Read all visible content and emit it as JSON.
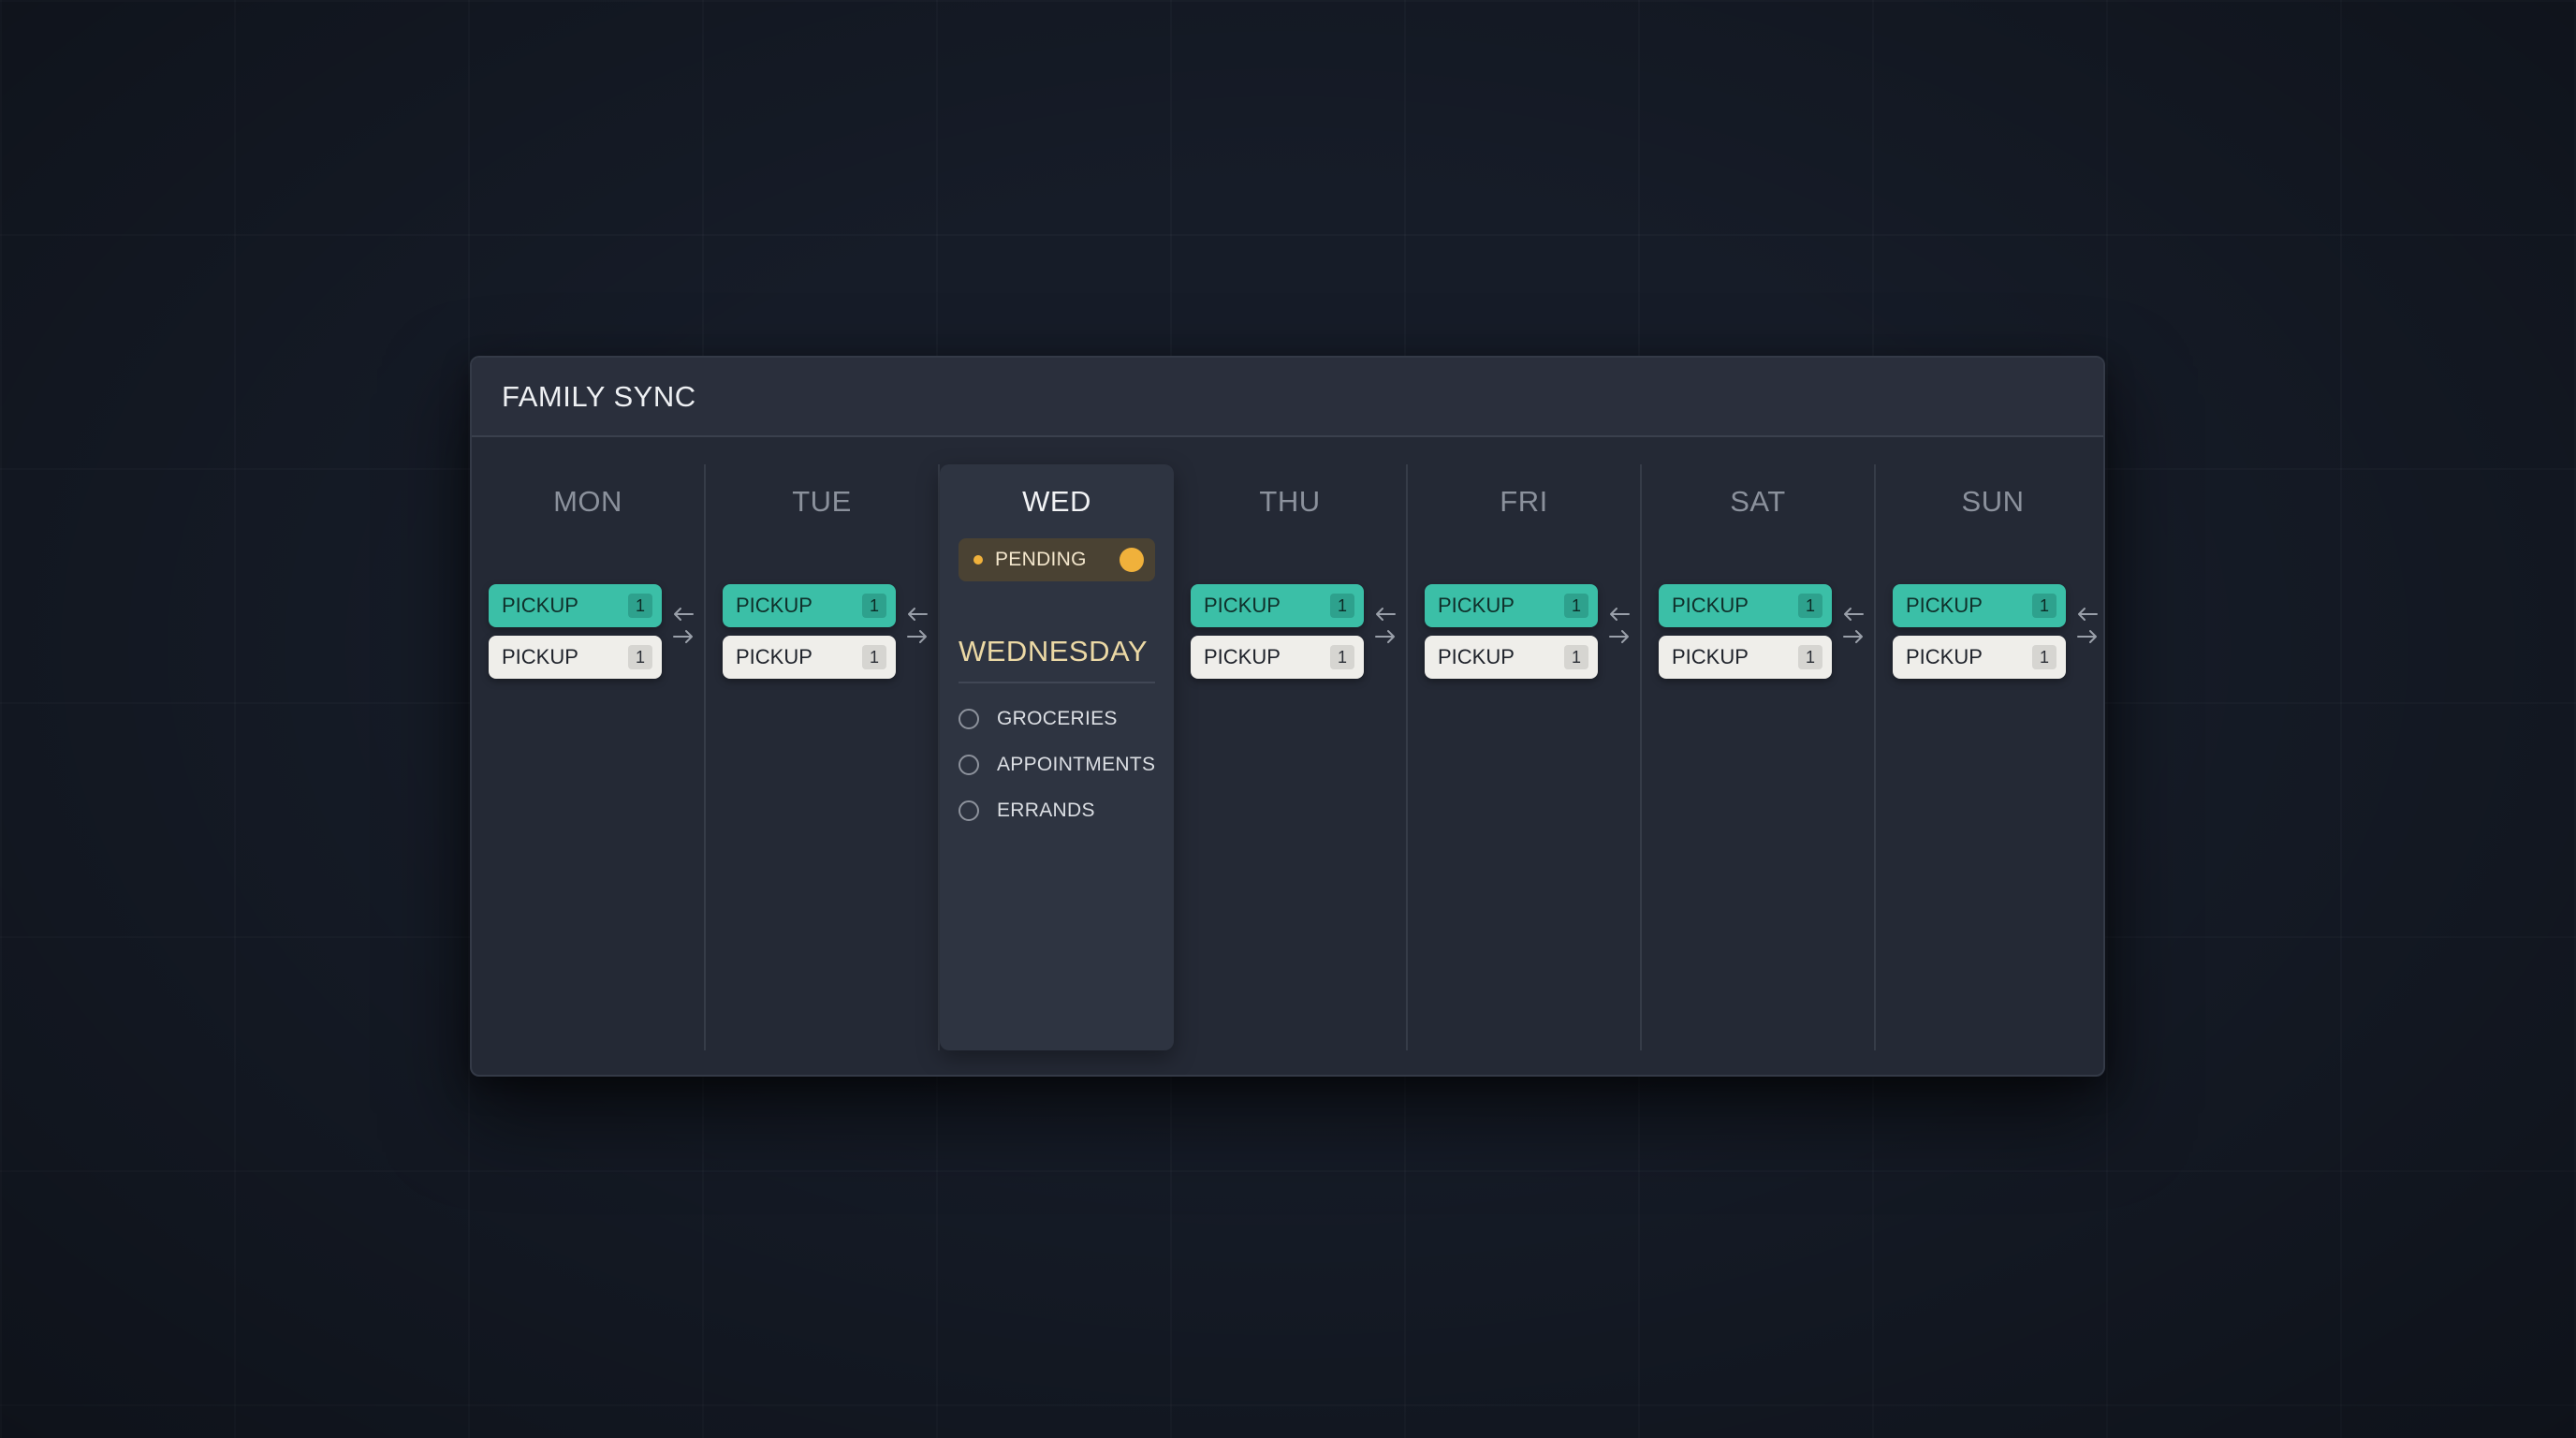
{
  "app": {
    "title": "FAMILY SYNC"
  },
  "days": [
    {
      "short": "MON",
      "pills": [
        {
          "label": "PICKUP",
          "count": "1"
        },
        {
          "label": "PICKUP",
          "count": "1"
        }
      ]
    },
    {
      "short": "TUE",
      "pills": [
        {
          "label": "PICKUP",
          "count": "1"
        },
        {
          "label": "PICKUP",
          "count": "1"
        }
      ]
    },
    {
      "short": "WED"
    },
    {
      "short": "THU",
      "pills": [
        {
          "label": "PICKUP",
          "count": "1"
        },
        {
          "label": "PICKUP",
          "count": "1"
        }
      ]
    },
    {
      "short": "FRI",
      "pills": [
        {
          "label": "PICKUP",
          "count": "1"
        },
        {
          "label": "PICKUP",
          "count": "1"
        }
      ]
    },
    {
      "short": "SAT",
      "pills": [
        {
          "label": "PICKUP",
          "count": "1"
        },
        {
          "label": "PICKUP",
          "count": "1"
        }
      ]
    },
    {
      "short": "SUN",
      "pills": [
        {
          "label": "PICKUP",
          "count": "1"
        },
        {
          "label": "PICKUP",
          "count": "1"
        }
      ]
    }
  ],
  "wednesday": {
    "status": "PENDING",
    "title": "WEDNESDAY",
    "tasks": [
      "GROCERIES",
      "APPOINTMENTS",
      "ERRANDS"
    ]
  },
  "icons": {
    "arrow_left": "arrow-left-icon",
    "arrow_right": "arrow-right-icon",
    "status_dot": "status-dot-icon",
    "toggle": "toggle-knob-icon",
    "task_radio": "radio-circle-icon"
  },
  "colors": {
    "background": "#161c28",
    "window": "#242935",
    "teal": "#3bbfa7",
    "pill_light": "#efeeea",
    "amber": "#f0b13b",
    "wednesday_title": "#ecd9a5"
  }
}
